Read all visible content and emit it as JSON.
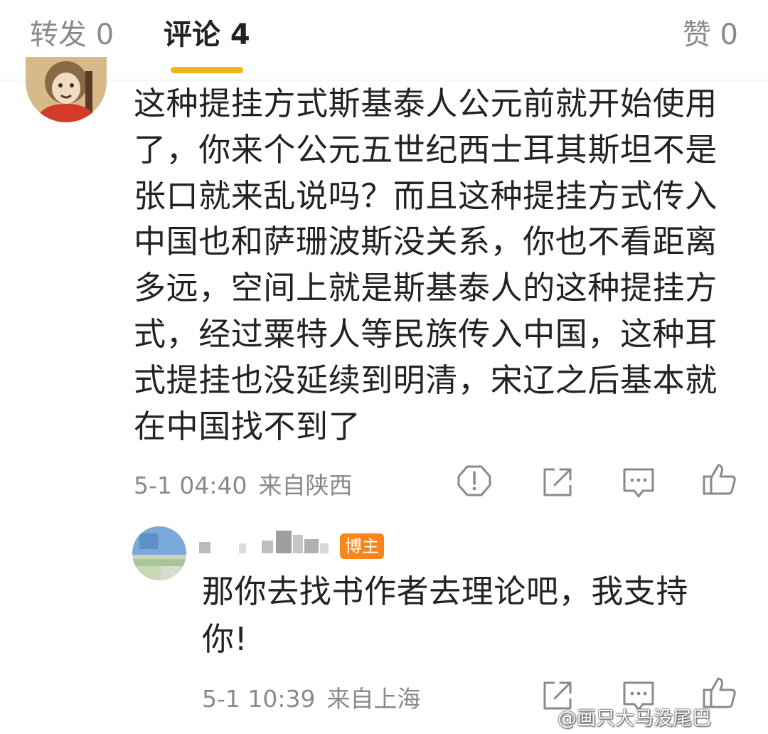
{
  "tabs": {
    "repost": "转发 0",
    "comments": "评论 4",
    "likes": "赞 0"
  },
  "comment": {
    "text": "这种提挂方式斯基泰人公元前就开始使用了，你来个公元五世纪西士耳其斯坦不是张口就来乱说吗？而且这种提挂方式传入中国也和萨珊波斯没关系，你也不看距离多远，空间上就是斯基泰人的这种提挂方式，经过粟特人等民族传入中国，这种耳式提挂也没延续到明清，宋辽之后基本就在中国找不到了",
    "time": "5-1 04:40",
    "location": "来自陕西",
    "actions": [
      "report-icon",
      "share-icon",
      "reply-icon",
      "like-icon"
    ]
  },
  "reply": {
    "badge": "博主",
    "text": "那你去找书作者去理论吧，我支持你!",
    "time": "5-1 10:39",
    "location": "来自上海",
    "actions": [
      "share-icon",
      "reply-icon",
      "like-icon"
    ]
  },
  "watermark": "@画只大马没尾巴",
  "colors": {
    "accent": "#f4b41a",
    "badge": "#f7861d",
    "text": "#222222",
    "muted": "#8a8a8a"
  }
}
